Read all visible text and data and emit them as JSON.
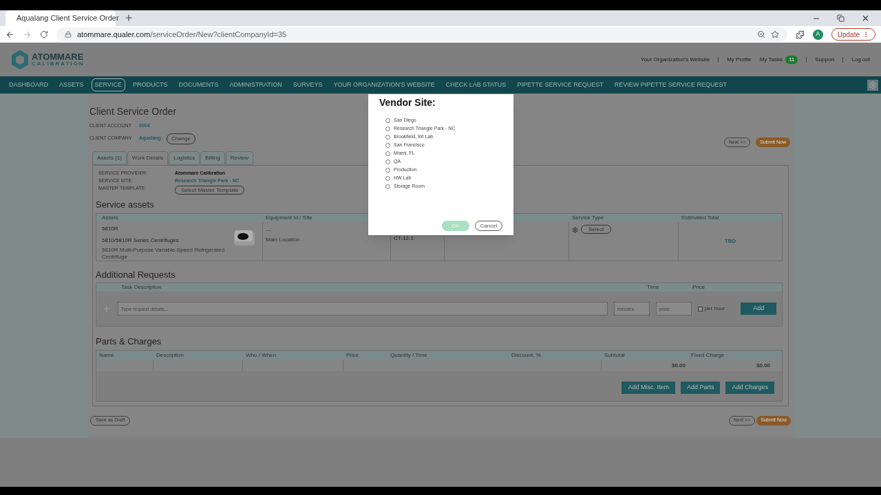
{
  "browser": {
    "tab_title": "Aqualang Client Service Order",
    "url_host": "atommare.qualer.com",
    "url_path": "/serviceOrder/New?clientCompanyId=35",
    "avatar": "A",
    "update": "Update"
  },
  "header": {
    "logo_top": "ATOMMARE",
    "logo_bottom": "CALIBRATION",
    "links": [
      {
        "label": "Your Organization's Website",
        "kind": "link"
      },
      {
        "label": "My Profile",
        "kind": "link"
      },
      {
        "label": "My Tasks",
        "kind": "tasks",
        "count": "11"
      },
      {
        "label": "Support",
        "kind": "link"
      },
      {
        "label": "Log out",
        "kind": "link"
      }
    ]
  },
  "nav": [
    {
      "label": "DASHBOARD",
      "selected": false
    },
    {
      "label": "ASSETS",
      "selected": false
    },
    {
      "label": "SERVICE",
      "selected": true
    },
    {
      "label": "PRODUCTS",
      "selected": false
    },
    {
      "label": "DOCUMENTS",
      "selected": false
    },
    {
      "label": "ADMINISTRATION",
      "selected": false
    },
    {
      "label": "SURVEYS",
      "selected": false
    },
    {
      "label": "YOUR ORGANIZATION'S WEBSITE",
      "selected": false
    },
    {
      "label": "CHECK LAB STATUS",
      "selected": false
    },
    {
      "label": "PIPETTE SERVICE REQUEST",
      "selected": false
    },
    {
      "label": "REVIEW PIPETTE SERVICE REQUEST",
      "selected": false
    }
  ],
  "order": {
    "title": "Client Service Order",
    "fields": [
      {
        "label": "CLIENT ACCOUNT",
        "value": "0004"
      },
      {
        "label": "CLIENT COMPANY",
        "value": "Aqualang",
        "action": "Change"
      }
    ],
    "next": "Next >>",
    "submit": "Submit Now"
  },
  "tabs": [
    {
      "label": "Assets (1)",
      "selected": false
    },
    {
      "label": "Work Details",
      "selected": true
    },
    {
      "label": "Logistics",
      "selected": false
    },
    {
      "label": "Billing",
      "selected": false
    },
    {
      "label": "Review",
      "selected": false
    }
  ],
  "details": [
    {
      "label": "SERVICE PROVIDER:",
      "value": "Atommare Calibration",
      "kind": "text"
    },
    {
      "label": "SERVICE SITE:",
      "value": "Research Triangle Park - NC",
      "kind": "link"
    },
    {
      "label": "MASTER TEMPLATE:",
      "value": "Select Master Template",
      "kind": "button"
    }
  ],
  "service_assets": {
    "title": "Service assets",
    "columns": [
      "Assets",
      "Equipment Id / Site",
      "Service Type",
      "Estimated Total"
    ],
    "row": {
      "model": "5810R",
      "name": "5810/5810R Series Centrifuges",
      "description": "5810R Multi-Purpose Variable-Speed Refrigerated Centrifuge",
      "equipment_id": "---",
      "site": "Main Location",
      "column_3": "CT-12-1",
      "service_type": "Select",
      "total": "TBD"
    }
  },
  "additional_requests": {
    "title": "Additional Requests",
    "columns": [
      "Task Description",
      "Time",
      "Price"
    ],
    "placeholder": "Type request details...",
    "time_placeholder": "minutes",
    "price_placeholder": "price",
    "per_hour": "per hour",
    "per_hour_checked": false,
    "add": "Add"
  },
  "parts": {
    "title": "Parts & Charges",
    "columns": [
      "Name",
      "Description",
      "Who / When",
      "Price",
      "Quantity / Time",
      "Discount, %",
      "Subtotal",
      "Fixed Charge"
    ],
    "subtotal": "$0.00",
    "fixed": "$0.00",
    "buttons": [
      "Add Misc. Item",
      "Add Parts",
      "Add Charges"
    ]
  },
  "footer": {
    "draft": "Save as Draft",
    "next": "Next >>",
    "submit": "Submit Now"
  },
  "modal": {
    "title": "Vendor Site:",
    "options": [
      {
        "label": "San Diego",
        "selected": false
      },
      {
        "label": "Research Triangle Park - NC",
        "selected": false
      },
      {
        "label": "Brookfield, WI Lab",
        "selected": false
      },
      {
        "label": "San Francisco",
        "selected": false
      },
      {
        "label": "Miami, FL",
        "selected": false
      },
      {
        "label": "QA",
        "selected": false
      },
      {
        "label": "Production",
        "selected": false
      },
      {
        "label": "HW Lab",
        "selected": false
      },
      {
        "label": "Storage Room",
        "selected": false
      }
    ],
    "ok": "OK",
    "ok_disabled": true,
    "cancel": "Cancel"
  }
}
